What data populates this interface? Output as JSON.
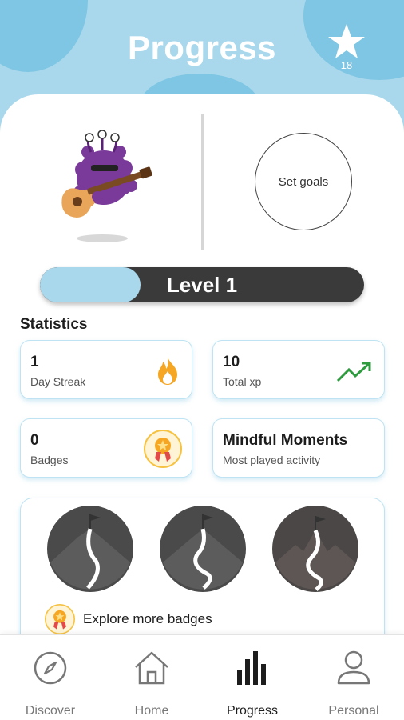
{
  "header": {
    "title": "Progress",
    "star_count": "18"
  },
  "goals": {
    "label": "Set goals"
  },
  "level": {
    "label": "Level 1",
    "progress_fraction": 0.31
  },
  "statistics": {
    "title": "Statistics",
    "day_streak": {
      "value": "1",
      "label": "Day Streak",
      "icon": "flame-icon"
    },
    "total_xp": {
      "value": "10",
      "label": "Total xp",
      "icon": "trending-up-icon"
    },
    "badges": {
      "value": "0",
      "label": "Badges",
      "icon": "medal-icon"
    },
    "most_played": {
      "value": "Mindful Moments",
      "label": "Most played activity"
    }
  },
  "badges_panel": {
    "explore_label": "Explore more badges"
  },
  "nav": {
    "items": [
      {
        "label": "Discover",
        "icon": "compass-icon"
      },
      {
        "label": "Home",
        "icon": "home-icon"
      },
      {
        "label": "Progress",
        "icon": "bar-chart-icon",
        "active": true
      },
      {
        "label": "Personal",
        "icon": "person-icon"
      }
    ]
  },
  "colors": {
    "accent": "#a9d8ec",
    "accent_dark": "#7ec6e3",
    "bar_dark": "#3a3a3a",
    "flame": "#f5a623",
    "trend": "#2e9b3e"
  }
}
